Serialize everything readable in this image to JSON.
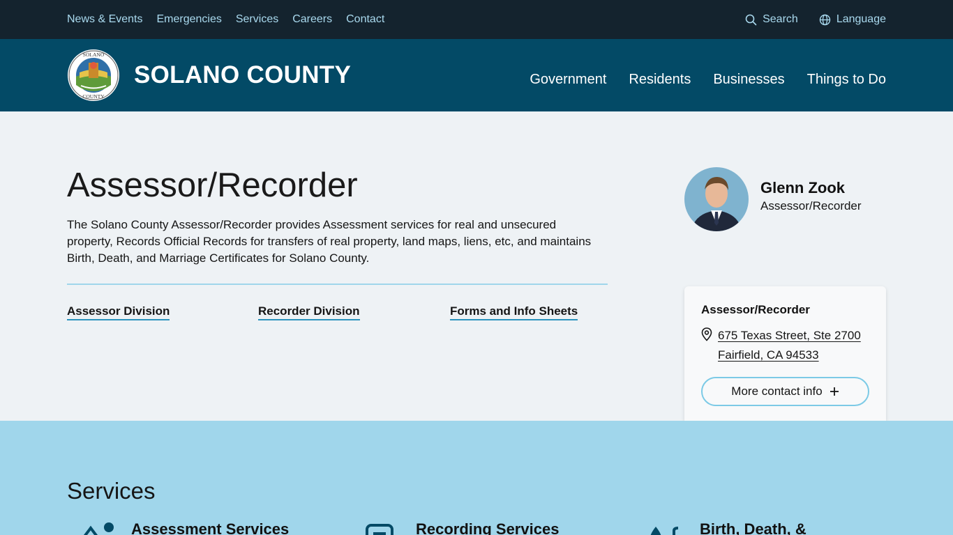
{
  "utility": {
    "links": [
      "News & Events",
      "Emergencies",
      "Services",
      "Careers",
      "Contact"
    ],
    "search_label": "Search",
    "language_label": "Language"
  },
  "header": {
    "county_name": "SOLANO COUNTY",
    "seal_text_top": "SOLANO",
    "seal_text_bottom": "COUNTY",
    "nav": [
      "Government",
      "Residents",
      "Businesses",
      "Things to Do"
    ]
  },
  "page": {
    "title": "Assessor/Recorder",
    "description": "The Solano County Assessor/Recorder provides Assessment services for real and unsecured property, Records Official Records for transfers of real property, land maps, liens, etc, and maintains Birth, Death, and Marriage Certificates for Solano County.",
    "quick_links": [
      "Assessor Division",
      "Recorder Division",
      "Forms and Info Sheets"
    ]
  },
  "official": {
    "name": "Glenn Zook",
    "role": "Assessor/Recorder"
  },
  "contact": {
    "title": "Assessor/Recorder",
    "address_line1": "675 Texas Street, Ste 2700",
    "address_line2": "Fairfield, CA 94533",
    "more_label": "More contact info"
  },
  "services": {
    "heading": "Services",
    "items": [
      {
        "title": "Assessment Services",
        "icon": "assessment-icon"
      },
      {
        "title": "Recording Services",
        "icon": "document-icon"
      },
      {
        "title": "Birth, Death, &",
        "icon": "vital-records-icon"
      }
    ]
  },
  "colors": {
    "utility_bg": "#14232e",
    "header_bg": "#034a66",
    "page_bg": "#eef2f5",
    "services_bg": "#a0d6eb",
    "link_accent": "#a9d9ee",
    "underline_accent": "#2b93bd"
  }
}
